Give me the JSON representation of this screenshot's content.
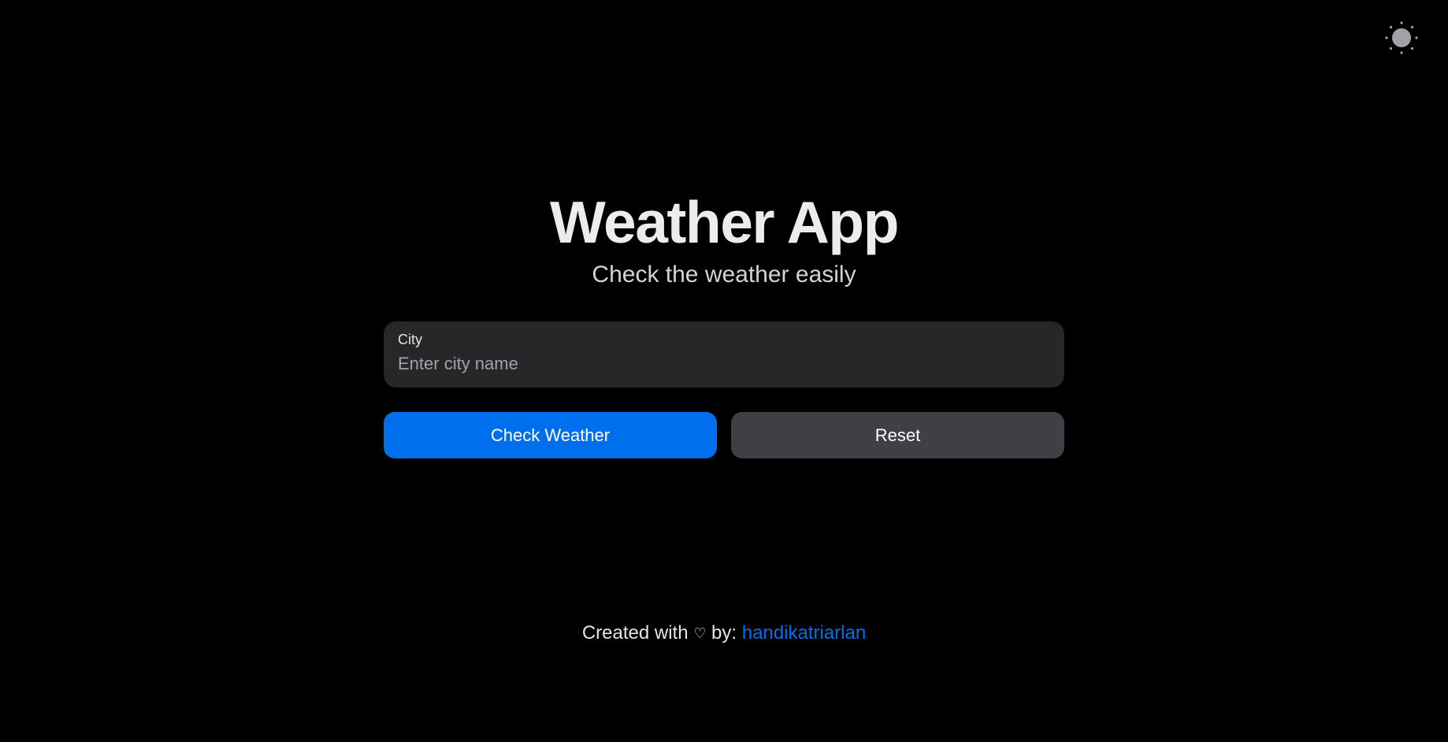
{
  "theme_toggle": {
    "icon": "sun-icon"
  },
  "header": {
    "title": "Weather App",
    "subtitle": "Check the weather easily"
  },
  "form": {
    "city_label": "City",
    "city_placeholder": "Enter city name",
    "city_value": ""
  },
  "buttons": {
    "check_label": "Check Weather",
    "reset_label": "Reset"
  },
  "footer": {
    "prefix": "Created with",
    "heart": "♡",
    "by": "by:",
    "author": "handikatriarlan"
  },
  "colors": {
    "background": "#000000",
    "primary": "#006fee",
    "secondary": "#3f3f46",
    "field": "#27272a"
  }
}
